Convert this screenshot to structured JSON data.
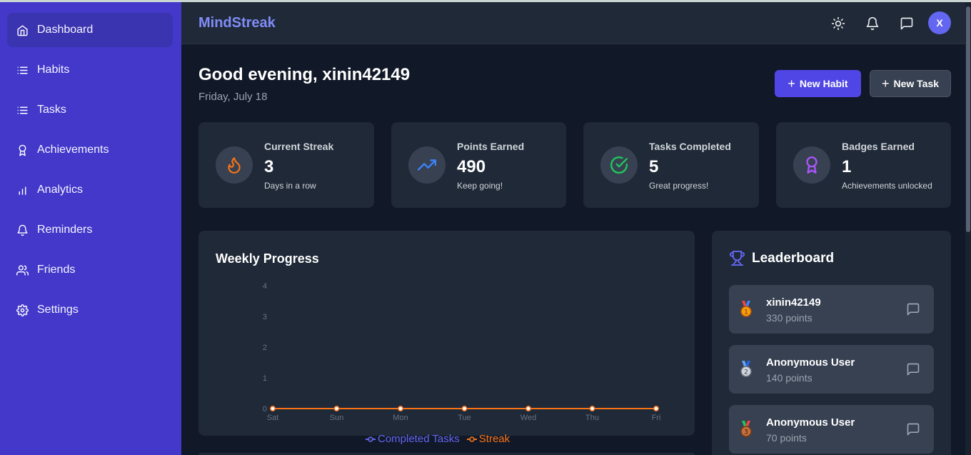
{
  "app": {
    "brand": "MindStreak",
    "avatar_initial": "X"
  },
  "sidebar": {
    "items": [
      {
        "label": "Dashboard",
        "icon": "home-icon",
        "active": true
      },
      {
        "label": "Habits",
        "icon": "list-icon"
      },
      {
        "label": "Tasks",
        "icon": "list-icon"
      },
      {
        "label": "Achievements",
        "icon": "award-icon"
      },
      {
        "label": "Analytics",
        "icon": "bar-chart-icon"
      },
      {
        "label": "Reminders",
        "icon": "bell-icon"
      },
      {
        "label": "Friends",
        "icon": "users-icon"
      },
      {
        "label": "Settings",
        "icon": "gear-icon"
      }
    ]
  },
  "header": {
    "icons": [
      "sun-icon",
      "bell-icon",
      "message-icon"
    ]
  },
  "greeting": {
    "title": "Good evening, xinin42149",
    "date": "Friday, July 18"
  },
  "actions": {
    "new_habit": "New Habit",
    "new_task": "New Task"
  },
  "stats": [
    {
      "title": "Current Streak",
      "value": "3",
      "sub": "Days in a row",
      "icon": "flame-icon",
      "color": "#f97316"
    },
    {
      "title": "Points Earned",
      "value": "490",
      "sub": "Keep going!",
      "icon": "trending-up-icon",
      "color": "#3b82f6"
    },
    {
      "title": "Tasks Completed",
      "value": "5",
      "sub": "Great progress!",
      "icon": "check-circle-icon",
      "color": "#22c55e"
    },
    {
      "title": "Badges Earned",
      "value": "1",
      "sub": "Achievements unlocked",
      "icon": "award-icon",
      "color": "#a855f7"
    }
  ],
  "weekly": {
    "title": "Weekly Progress"
  },
  "chart_data": {
    "type": "line",
    "x": [
      "Sat",
      "Sun",
      "Mon",
      "Tue",
      "Wed",
      "Thu",
      "Fri"
    ],
    "yticks": [
      0,
      1,
      2,
      3,
      4
    ],
    "ylim": [
      0,
      4
    ],
    "series": [
      {
        "name": "Completed Tasks",
        "values": [
          0,
          0,
          0,
          0,
          0,
          0,
          0
        ],
        "color": "#6366f1"
      },
      {
        "name": "Streak",
        "values": [
          0,
          0,
          0,
          0,
          0,
          0,
          0
        ],
        "color": "#f97316"
      }
    ],
    "grid": false,
    "legend": "bottom"
  },
  "leaderboard": {
    "title": "Leaderboard",
    "entries": [
      {
        "name": "xinin42149",
        "points": "330 points",
        "medal": "gold-medal-icon"
      },
      {
        "name": "Anonymous User",
        "points": "140 points",
        "medal": "silver-medal-icon"
      },
      {
        "name": "Anonymous User",
        "points": "70 points",
        "medal": "bronze-medal-icon"
      }
    ]
  }
}
